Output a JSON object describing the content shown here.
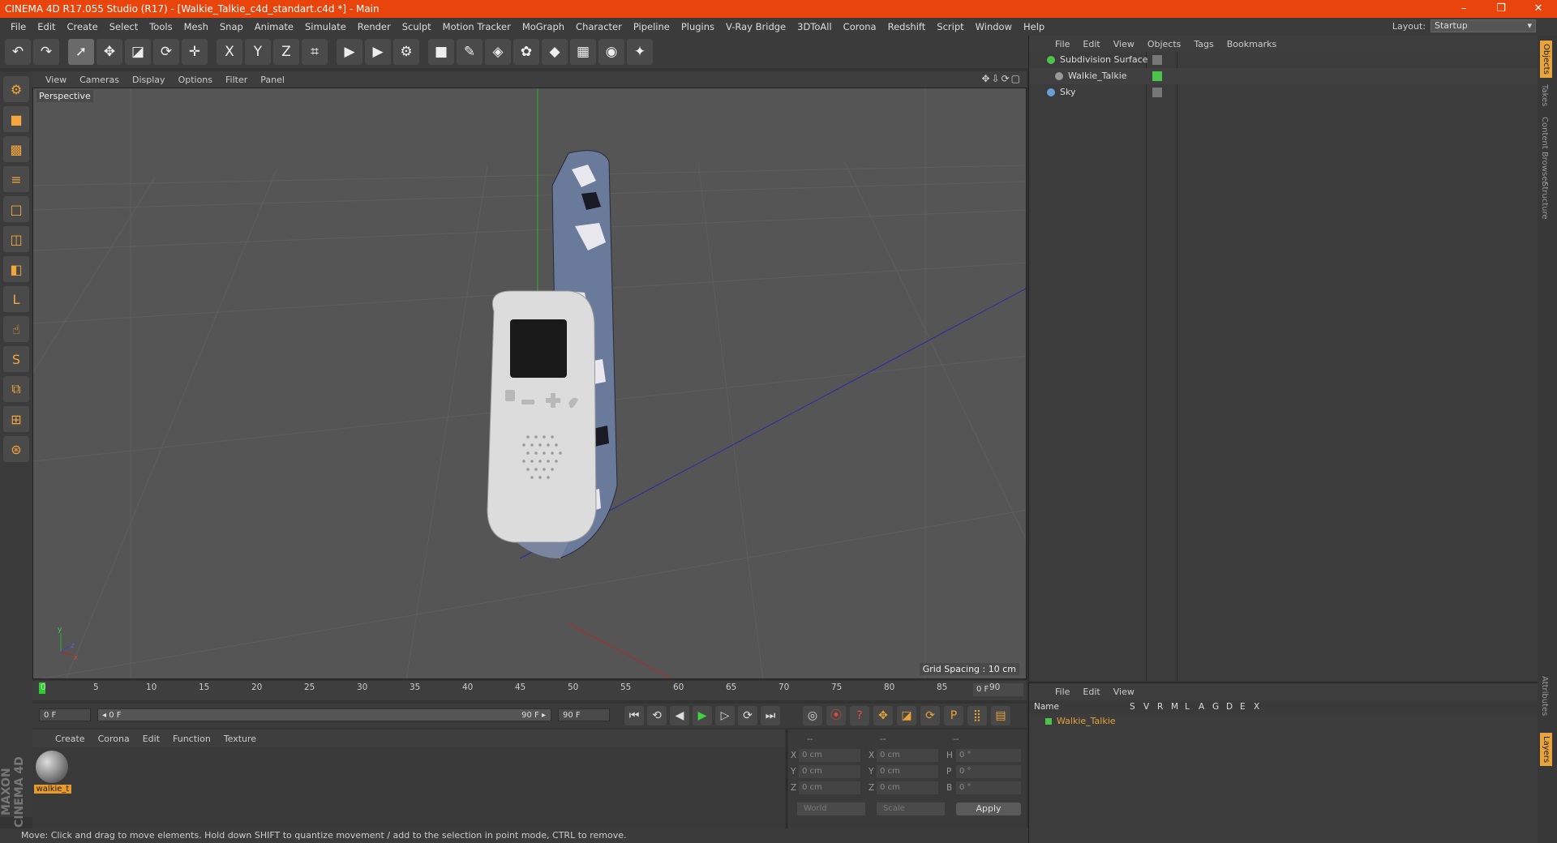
{
  "title": {
    "text": "CINEMA 4D R17.055 Studio (R17) - [Walkie_Talkie_c4d_standart.c4d *] - Main",
    "minimize": "–",
    "restore": "❐",
    "close": "✕"
  },
  "menubar": {
    "items": [
      "File",
      "Edit",
      "Create",
      "Select",
      "Tools",
      "Mesh",
      "Snap",
      "Animate",
      "Simulate",
      "Render",
      "Sculpt",
      "Motion Tracker",
      "MoGraph",
      "Character",
      "Pipeline",
      "Plugins",
      "V-Ray Bridge",
      "3DToAll",
      "Corona",
      "Redshift",
      "Script",
      "Window",
      "Help"
    ],
    "layout_label": "Layout:",
    "layout_value": "Startup"
  },
  "toolbar": {
    "undo": "↶",
    "redo": "↷",
    "select": "➚",
    "move": "✥",
    "scale": "◪",
    "rotate": "⟳",
    "transform": "✛",
    "x_axis": "X",
    "y_axis": "Y",
    "z_axis": "Z",
    "coord": "⌗",
    "render_view": "▶",
    "render_pv": "▶",
    "render_settings": "⚙",
    "cube": "■",
    "pen": "✎",
    "subdivision": "◈",
    "cloner": "✿",
    "deformer": "◆",
    "floor": "▦",
    "camera": "◉",
    "light": "✦"
  },
  "lefttools": [
    "⚙",
    "■",
    "▩",
    "≡",
    "□",
    "◫",
    "◧",
    "L",
    "☝",
    "S",
    "⧉",
    "⊞",
    "⊛"
  ],
  "maxon_logo": "MAXON CINEMA 4D",
  "viewport": {
    "menu": [
      "View",
      "Cameras",
      "Display",
      "Options",
      "Filter",
      "Panel"
    ],
    "nav_icons": "✥⇩⟳▢",
    "label": "Perspective",
    "grid_spacing": "Grid Spacing : 10 cm",
    "axis_x": "x",
    "axis_y": "y",
    "axis_z": "z"
  },
  "timeline": {
    "ticks": [
      "0",
      "5",
      "10",
      "15",
      "20",
      "25",
      "30",
      "35",
      "40",
      "45",
      "50",
      "55",
      "60",
      "65",
      "70",
      "75",
      "80",
      "85",
      "90"
    ],
    "current_frame": "0 F"
  },
  "transport": {
    "start_field": "0 F",
    "range_start": "◂ 0 F",
    "range_end": "90 F ▸",
    "end_field": "90 F",
    "buttons": [
      "⏮",
      "⟲",
      "◀",
      "▶",
      "▷",
      "⟳",
      "⏭"
    ],
    "record_buttons": [
      "◎",
      "⦿",
      "?",
      "✥",
      "◪",
      "⟳",
      "P",
      "⣿",
      "▤"
    ]
  },
  "material_manager": {
    "menu": [
      "Create",
      "Corona",
      "Edit",
      "Function",
      "Texture"
    ],
    "material_name": "walkie_t"
  },
  "coordinates": {
    "header": [
      "--",
      "--",
      "--"
    ],
    "rows": [
      {
        "axis": "X",
        "pos": "0 cm",
        "axis2": "X",
        "size": "0 cm",
        "rot_label": "H",
        "rot": "0 °"
      },
      {
        "axis": "Y",
        "pos": "0 cm",
        "axis2": "Y",
        "size": "0 cm",
        "rot_label": "P",
        "rot": "0 °"
      },
      {
        "axis": "Z",
        "pos": "0 cm",
        "axis2": "Z",
        "size": "0 cm",
        "rot_label": "B",
        "rot": "0 °"
      }
    ],
    "mode1": "World",
    "mode2": "Scale",
    "apply": "Apply"
  },
  "statusbar": {
    "text": "Move: Click and drag to move elements. Hold down SHIFT to quantize movement / add to the selection in point mode, CTRL to remove."
  },
  "object_manager": {
    "menu": [
      "File",
      "Edit",
      "View",
      "Objects",
      "Tags",
      "Bookmarks"
    ],
    "objects": [
      {
        "name": "Subdivision Surface",
        "color": "#4cc44c"
      },
      {
        "name": "Walkie_Talkie",
        "color": "#999999"
      },
      {
        "name": "Sky",
        "color": "#6aa0d8"
      }
    ]
  },
  "layer_manager": {
    "menu": [
      "File",
      "Edit",
      "View"
    ],
    "columns": [
      "Name",
      "S",
      "V",
      "R",
      "M",
      "L",
      "A",
      "G",
      "D",
      "E",
      "X"
    ],
    "layers": [
      {
        "name": "Walkie_Talkie",
        "color": "#4cc44c"
      }
    ]
  },
  "side_tabs": [
    "Objects",
    "Takes",
    "Content Browser",
    "Structure",
    "Attributes",
    "Layers"
  ],
  "colors": {
    "title_bar": "#e8440c",
    "accent_orange": "#e8a33a",
    "green_axis": "#2fae2f",
    "blue_axis": "#2a2aa8",
    "red_axis": "#b02a2a"
  }
}
